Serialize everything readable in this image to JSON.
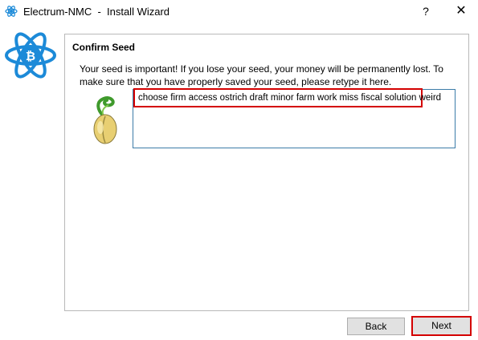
{
  "window": {
    "title": "Electrum-NMC  -  Install Wizard",
    "help_label": "?",
    "close_label": "✕",
    "app_icon": "electrum-atom-icon"
  },
  "logo": {
    "icon": "bitcoin-atom-logo",
    "color": "#1c8ad8",
    "symbol": "₿"
  },
  "panel": {
    "title": "Confirm Seed",
    "description": "Your seed is important! If you lose your seed, your money will be permanently lost. To make sure that you have properly saved your seed, please retype it here.",
    "seed_icon": "sprouting-seed-icon",
    "seed_text": "choose firm access ostrich draft minor farm work miss fiscal solution weird"
  },
  "buttons": {
    "back": "Back",
    "next": "Next"
  },
  "colors": {
    "highlight": "#d40000",
    "input_border": "#3c7ca8",
    "accent": "#1c8ad8"
  }
}
